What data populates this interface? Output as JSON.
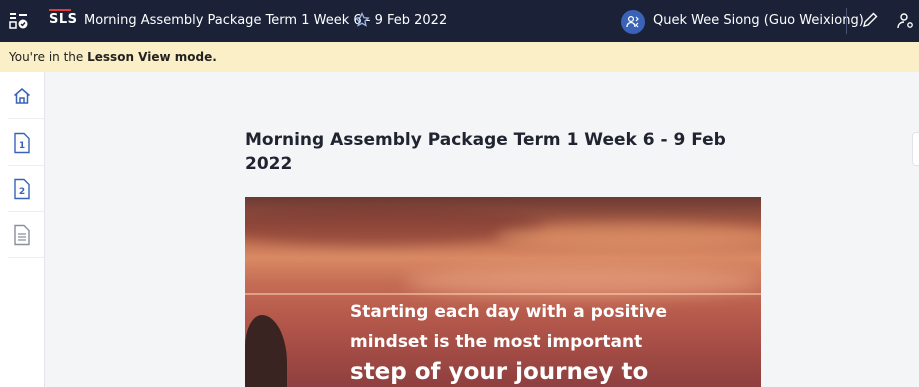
{
  "header": {
    "app_logo": "SLS",
    "lesson_title": "Morning Assembly Package Term 1 Week 6 - 9 Feb 2022",
    "user_name": "Quek Wee Siong (Guo Weixiong)",
    "icons": [
      "app-menu-icon",
      "star-icon",
      "user-switch-icon",
      "pencil-icon",
      "share-icon"
    ]
  },
  "notice": {
    "prefix": "You're in the ",
    "mode": "Lesson View mode."
  },
  "sidebar": {
    "items": [
      {
        "icon": "home-icon"
      },
      {
        "icon": "page-1-icon",
        "label": "1"
      },
      {
        "icon": "page-2-icon",
        "label": "2"
      },
      {
        "icon": "document-icon"
      }
    ]
  },
  "main": {
    "title": "Morning Assembly Package Term 1 Week 6 - 9 Feb 2022",
    "banner": {
      "line1": "Starting each day with a positive",
      "line2": "mindset is the most important",
      "line3": "step of your journey to"
    }
  },
  "colors": {
    "topbar": "#1b2238",
    "notice_bg": "#fbefc7",
    "accent": "#3a63b8",
    "logo_red": "#e53935"
  }
}
